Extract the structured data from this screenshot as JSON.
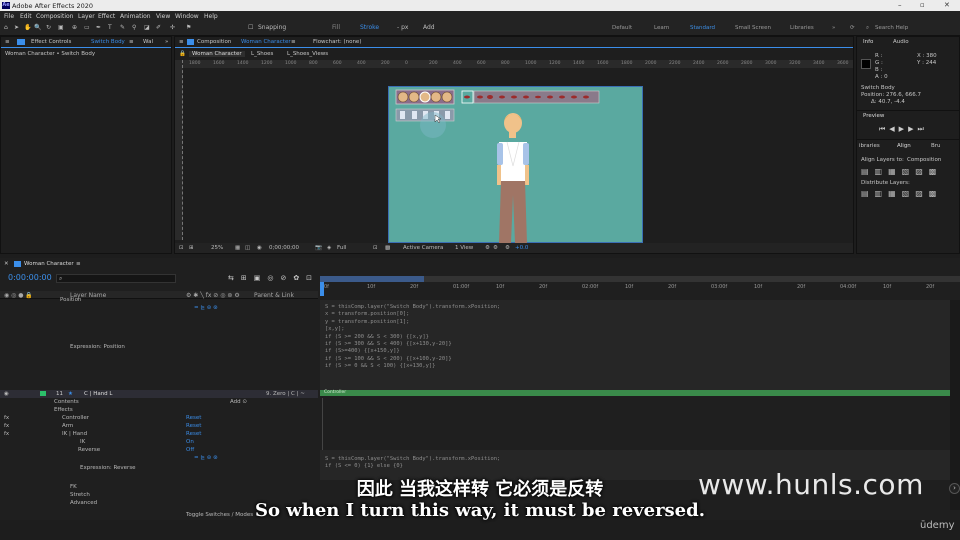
{
  "app": {
    "title": "Adobe After Effects 2020",
    "logo": "Ae"
  },
  "menu": [
    "File",
    "Edit",
    "Composition",
    "Layer",
    "Effect",
    "Animation",
    "View",
    "Window",
    "Help"
  ],
  "toolbar": {
    "snapping": "Snapping",
    "fill": "Fill",
    "stroke": "Stroke",
    "px": "- px",
    "add": "Add"
  },
  "workspaces": [
    "Default",
    "Learn",
    "Standard",
    "Small Screen",
    "Libraries"
  ],
  "workspace_active": "Standard",
  "search": {
    "placeholder": "Search Help"
  },
  "left_panel": {
    "tab": "Effect Controls",
    "tab_layer": "Switch Body",
    "tab2": "Wal",
    "subtitle": "Woman Character • Switch Body"
  },
  "comp_panel": {
    "tab": "Composition",
    "tab_name": "Woman Character",
    "flowchart": "Flowchart: (none)",
    "subtabs": [
      "Woman Character",
      "L_Shoes",
      "L_Shoes_Views"
    ],
    "zoom": "25%",
    "time": "0;00;00;00",
    "quality": "Full",
    "camera": "Active Camera",
    "view": "1 View",
    "offset": "+0.0"
  },
  "ruler_ticks": [
    "1800",
    "1600",
    "1400",
    "1200",
    "1000",
    "800",
    "600",
    "400",
    "200",
    "0",
    "200",
    "400",
    "600",
    "800",
    "1000",
    "1200",
    "1400",
    "1600",
    "1800",
    "2000",
    "2200",
    "2400",
    "2600",
    "2800",
    "3000",
    "3200",
    "3400",
    "3600"
  ],
  "right_panel": {
    "tabs": [
      "Info",
      "Audio"
    ],
    "info": {
      "r": "R :",
      "g": "G :",
      "b": "B :",
      "a": "A : 0",
      "x": "X : 380",
      "y": "Y : 244"
    },
    "layer_name": "Switch Body",
    "position": "Position: 276.6, 666.7",
    "delta": "Δ: 40.7, -4.4",
    "preview": "Preview",
    "libraries": "ibraries",
    "align": "Align",
    "brush": "Bru",
    "align_to_label": "Align Layers to:",
    "align_to": "Composition",
    "distribute": "Distribute Layers:"
  },
  "timeline": {
    "comp_name": "Woman Character",
    "timecode": "0:00:00:00",
    "col_layer": "Layer Name",
    "col_parent": "Parent & Link",
    "time_marks": [
      "0f",
      "10f",
      "20f",
      "01:00f",
      "10f",
      "20f",
      "02:00f",
      "10f",
      "20f",
      "03:00f",
      "10f",
      "20f",
      "04:00f",
      "10f",
      "20f"
    ],
    "layers": [
      {
        "label": "Position",
        "indent": 60
      },
      {
        "label": "Expression: Position",
        "indent": 70
      },
      {
        "label": "C | Hand L",
        "num": "11",
        "indent": 84,
        "parent": "9. Zero | C | ~"
      },
      {
        "label": "Contents",
        "indent": 54
      },
      {
        "label": "Effects",
        "indent": 54
      },
      {
        "label": "Controller",
        "indent": 62,
        "reset": "Reset"
      },
      {
        "label": "Arm",
        "indent": 62,
        "reset": "Reset"
      },
      {
        "label": "IK | Hand",
        "indent": 62,
        "reset": "Reset"
      },
      {
        "label": "IK",
        "indent": 80,
        "value": "On"
      },
      {
        "label": "Reverse",
        "indent": 78,
        "value": "Off"
      },
      {
        "label": "Expression: Reverse",
        "indent": 80
      },
      {
        "label": "FK",
        "indent": 70
      },
      {
        "label": "Stretch",
        "indent": 70
      },
      {
        "label": "Advanced",
        "indent": 70
      }
    ],
    "bar_label": "Controller",
    "toggle": "Toggle Switches / Modes",
    "code1": [
      "S = thisComp.layer(\"Switch Body\").transform.xPosition;",
      "x = transform.position[0];",
      "y = transform.position[1];",
      "[x,y];",
      "if (S >= 200 && S < 300) {[x,y]}",
      "if (S >= 300 && S < 400) {[x+130,y-20]}",
      "if (S>=400) {[x+150,y]}",
      "if (S >= 100 && S < 200) {[x+100,y-20]}",
      "if (S >= 0 && S < 100) {[x+130,y]}"
    ],
    "code2": [
      "S = thisComp.layer(\"Switch Body\").transform.xPosition;",
      "if (S <= 0) {1} else {0}"
    ]
  },
  "subtitle_cn": "因此 当我这样转 它必须是反转",
  "subtitle_en": "So when I turn this way, it must be reversed.",
  "watermark": "www.hunls.com",
  "udemy": "ūdemy"
}
